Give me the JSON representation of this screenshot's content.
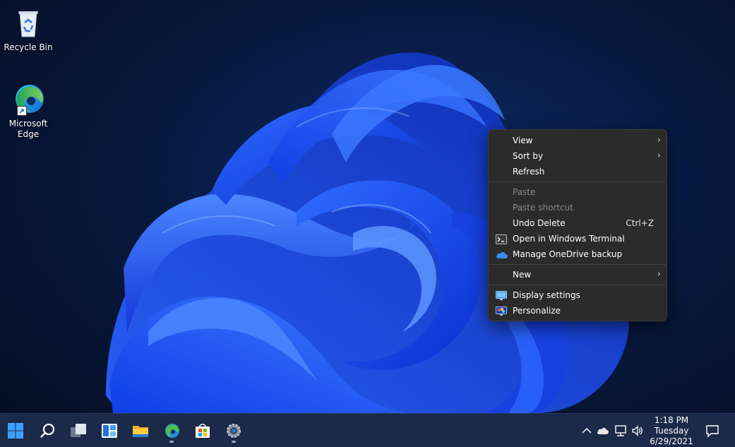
{
  "desktop": {
    "icons": [
      {
        "label": "Recycle Bin",
        "icon": "recycle-bin-icon"
      },
      {
        "label": "Microsoft Edge",
        "icon": "edge-icon"
      }
    ]
  },
  "context_menu": {
    "items": [
      {
        "label": "View",
        "submenu": true
      },
      {
        "label": "Sort by",
        "submenu": true
      },
      {
        "label": "Refresh"
      },
      {
        "label": "Paste",
        "disabled": true
      },
      {
        "label": "Paste shortcut",
        "disabled": true
      },
      {
        "label": "Undo Delete",
        "shortcut": "Ctrl+Z"
      },
      {
        "label": "Open in Windows Terminal",
        "icon": "terminal-icon"
      },
      {
        "label": "Manage OneDrive backup",
        "icon": "onedrive-icon"
      },
      {
        "label": "New",
        "submenu": true
      },
      {
        "label": "Display settings",
        "icon": "display-icon"
      },
      {
        "label": "Personalize",
        "icon": "personalize-icon"
      }
    ]
  },
  "taskbar": {
    "apps": [
      "start-icon",
      "search-icon",
      "task-view-icon",
      "widgets-icon",
      "file-explorer-icon",
      "edge-icon",
      "store-icon",
      "settings-icon"
    ],
    "tray_icons": [
      "chevron-up-icon",
      "onedrive-icon",
      "network-icon",
      "volume-icon"
    ],
    "clock": {
      "time": "1:18 PM",
      "day": "Tuesday",
      "date": "6/29/2021"
    },
    "notification_icon": "notification-icon"
  },
  "colors": {
    "accent": "#1f5cff",
    "menu_bg": "#2b2b2b",
    "taskbar_bg": "#1c2a4a"
  }
}
